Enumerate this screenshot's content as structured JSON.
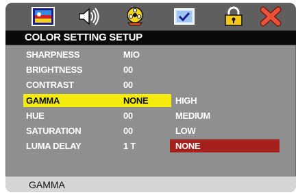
{
  "tabs": [
    {
      "icon": "picture-icon"
    },
    {
      "icon": "speaker-icon"
    },
    {
      "icon": "film-reel-icon"
    },
    {
      "icon": "checkbox-icon"
    },
    {
      "icon": "lock-icon"
    },
    {
      "icon": "close-icon"
    }
  ],
  "menu": {
    "title": "COLOR SETTING SETUP",
    "rows": [
      {
        "label": "SHARPNESS",
        "value": "MIO"
      },
      {
        "label": "BRIGHTNESS",
        "value": "00"
      },
      {
        "label": "CONTRAST",
        "value": "00"
      },
      {
        "label": "GAMMA",
        "value": "NONE"
      },
      {
        "label": "HUE",
        "value": "00"
      },
      {
        "label": "SATURATION",
        "value": "00"
      },
      {
        "label": "LUMA DELAY",
        "value": "1 T"
      }
    ],
    "selected_row": "GAMMA",
    "options": [
      "HIGH",
      "MEDIUM",
      "LOW",
      "NONE"
    ],
    "selected_option": "NONE"
  },
  "hint": "GAMMA",
  "colors": {
    "highlight_row": "#f5ec0f",
    "highlight_option": "#a3201d",
    "panel": "#8f8f8f",
    "tabbar": "#5f5f5f",
    "heading": "#0a0a0a",
    "hintbar": "#d5d5d5"
  }
}
